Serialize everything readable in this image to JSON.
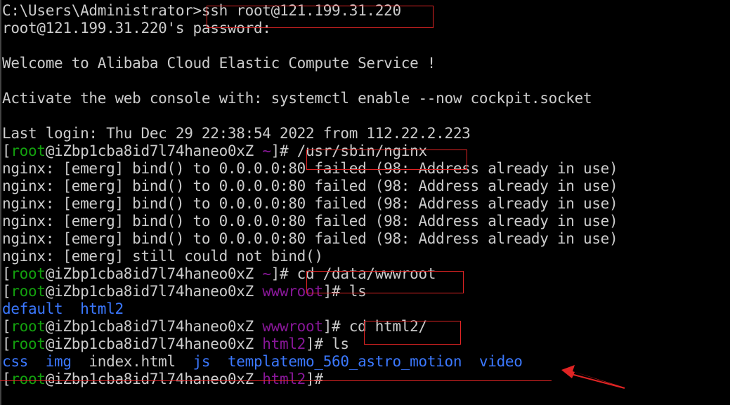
{
  "terminal": {
    "lines": [
      [
        {
          "t": "C:\\Users\\Administrator>",
          "c": "norm"
        },
        {
          "t": "ssh root@121.199.31.220",
          "c": "norm"
        }
      ],
      [
        {
          "t": "root@121.199.31.220's password:",
          "c": "norm"
        }
      ],
      [],
      [
        {
          "t": "Welcome to Alibaba Cloud Elastic Compute Service !",
          "c": "norm"
        }
      ],
      [],
      [
        {
          "t": "Activate the web console with: systemctl enable --now cockpit.socket",
          "c": "norm"
        }
      ],
      [],
      [
        {
          "t": "Last login: Thu Dec 29 22:38:54 2022 from 112.22.2.223",
          "c": "norm"
        }
      ],
      [
        {
          "t": "[",
          "c": "norm"
        },
        {
          "t": "root",
          "c": "user"
        },
        {
          "t": "@iZbp1cba8id7l74haneo0xZ ",
          "c": "norm"
        },
        {
          "t": "~",
          "c": "dir"
        },
        {
          "t": "]# ",
          "c": "norm"
        },
        {
          "t": "/usr/sbin/nginx",
          "c": "norm"
        }
      ],
      [
        {
          "t": "nginx: [emerg] bind() to 0.0.0.0:80 failed (98: Address already in use)",
          "c": "norm"
        }
      ],
      [
        {
          "t": "nginx: [emerg] bind() to 0.0.0.0:80 failed (98: Address already in use)",
          "c": "norm"
        }
      ],
      [
        {
          "t": "nginx: [emerg] bind() to 0.0.0.0:80 failed (98: Address already in use)",
          "c": "norm"
        }
      ],
      [
        {
          "t": "nginx: [emerg] bind() to 0.0.0.0:80 failed (98: Address already in use)",
          "c": "norm"
        }
      ],
      [
        {
          "t": "nginx: [emerg] bind() to 0.0.0.0:80 failed (98: Address already in use)",
          "c": "norm"
        }
      ],
      [
        {
          "t": "nginx: [emerg] still could not bind()",
          "c": "norm"
        }
      ],
      [
        {
          "t": "[",
          "c": "norm"
        },
        {
          "t": "root",
          "c": "user"
        },
        {
          "t": "@iZbp1cba8id7l74haneo0xZ ",
          "c": "norm"
        },
        {
          "t": "~",
          "c": "dir"
        },
        {
          "t": "]# ",
          "c": "norm"
        },
        {
          "t": "cd /data/wwwroot",
          "c": "norm"
        }
      ],
      [
        {
          "t": "[",
          "c": "norm"
        },
        {
          "t": "root",
          "c": "user"
        },
        {
          "t": "@iZbp1cba8id7l74haneo0xZ ",
          "c": "norm"
        },
        {
          "t": "wwwroot",
          "c": "dir"
        },
        {
          "t": "]# ",
          "c": "norm"
        },
        {
          "t": "ls",
          "c": "norm"
        }
      ],
      [
        {
          "t": "default",
          "c": "blue"
        },
        {
          "t": "  ",
          "c": "norm"
        },
        {
          "t": "html2",
          "c": "blue"
        }
      ],
      [
        {
          "t": "[",
          "c": "norm"
        },
        {
          "t": "root",
          "c": "user"
        },
        {
          "t": "@iZbp1cba8id7l74haneo0xZ ",
          "c": "norm"
        },
        {
          "t": "wwwroot",
          "c": "dir"
        },
        {
          "t": "]# ",
          "c": "norm"
        },
        {
          "t": "cd html2/",
          "c": "norm"
        }
      ],
      [
        {
          "t": "[",
          "c": "norm"
        },
        {
          "t": "root",
          "c": "user"
        },
        {
          "t": "@iZbp1cba8id7l74haneo0xZ ",
          "c": "norm"
        },
        {
          "t": "html2",
          "c": "dir"
        },
        {
          "t": "]# ",
          "c": "norm"
        },
        {
          "t": "ls",
          "c": "norm"
        }
      ],
      [
        {
          "t": "css",
          "c": "blue"
        },
        {
          "t": "  ",
          "c": "norm"
        },
        {
          "t": "img",
          "c": "blue"
        },
        {
          "t": "  index.html  ",
          "c": "norm"
        },
        {
          "t": "js",
          "c": "blue"
        },
        {
          "t": "  ",
          "c": "norm"
        },
        {
          "t": "templatemo_560_astro_motion",
          "c": "blue"
        },
        {
          "t": "  ",
          "c": "norm"
        },
        {
          "t": "video",
          "c": "blue"
        }
      ],
      [
        {
          "t": "[",
          "c": "norm"
        },
        {
          "t": "root",
          "c": "user"
        },
        {
          "t": "@iZbp1cba8id7l74haneo0xZ ",
          "c": "norm"
        },
        {
          "t": "html2",
          "c": "dir"
        },
        {
          "t": "]#",
          "c": "norm"
        }
      ]
    ]
  },
  "colors": {
    "background": "#000000",
    "text": "#cccccc",
    "user": "#13a10e",
    "directory": "#881798",
    "listing": "#3b78ff",
    "annotation": "#e02424"
  }
}
